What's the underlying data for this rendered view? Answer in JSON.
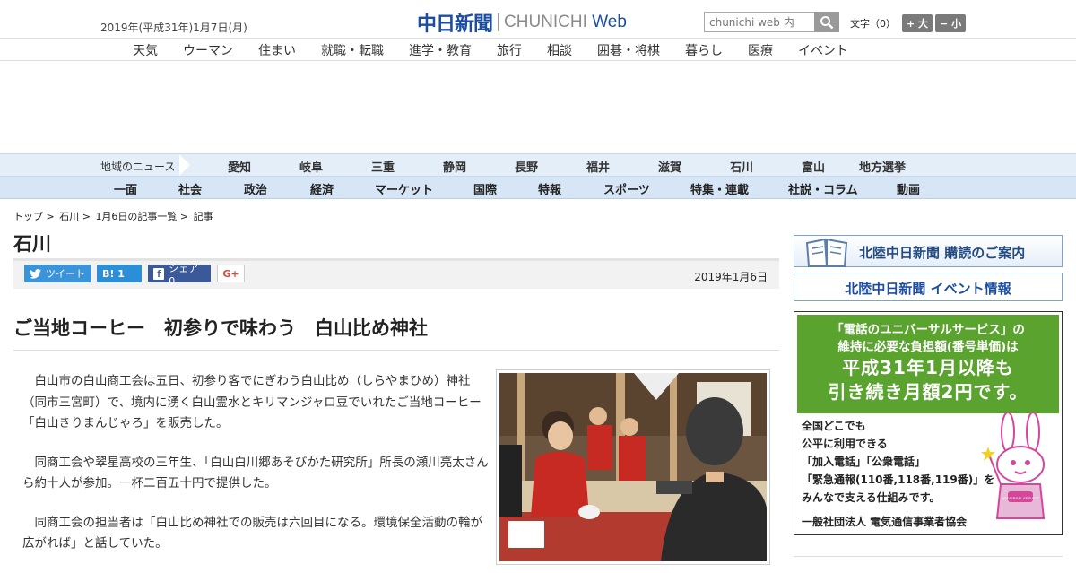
{
  "header": {
    "date": "2019年(平成31年)1月7日(月)",
    "logo_jp": "中日新聞",
    "logo_en_a": "CHUNICHI ",
    "logo_en_b": "Web",
    "search_placeholder": "chunichi web 内",
    "font_label": "文字（0）",
    "font_large": "+ 大",
    "font_small": "− 小"
  },
  "nav_main": [
    "天気",
    "ウーマン",
    "住まい",
    "就職・転職",
    "進学・教育",
    "旅行",
    "相談",
    "囲碁・将棋",
    "暮らし",
    "医療",
    "イベント"
  ],
  "nav_region": {
    "label": "地域のニュース",
    "items": [
      "愛知",
      "岐阜",
      "三重",
      "静岡",
      "長野",
      "福井",
      "滋賀",
      "石川",
      "富山",
      "地方選挙"
    ]
  },
  "nav_category": [
    "一面",
    "社会",
    "政治",
    "経済",
    "マーケット",
    "国際",
    "特報",
    "スポーツ",
    "特集・連載",
    "社説・コラム",
    "動画"
  ],
  "breadcrumb": [
    "トップ",
    "石川",
    "1月6日の記事一覧",
    "記事"
  ],
  "section_title": "石川",
  "share": {
    "tweet": "ツイート",
    "hatena": "B! 1",
    "facebook": "シェア 0",
    "gplus": "G+"
  },
  "article": {
    "date": "2019年1月6日",
    "headline": "ご当地コーヒー　初参りで味わう　白山比め神社",
    "paragraphs": [
      "白山市の白山商工会は五日、初参り客でにぎわう白山比め（しらやまひめ）神社（同市三宮町）で、境内に湧く白山霊水とキリマンジャロ豆でいれたご当地コーヒー「白山きりまんじゃろ」を販売した。",
      "同商工会や翠星高校の三年生、「白山白川郷あそびかた研究所」所長の瀬川亮太さんら約十人が参加。一杯二百五十円で提供した。",
      "同商工会の担当者は「白山比め神社での販売は六回目になる。環境保全活動の輪が広がれば」と話していた。"
    ]
  },
  "sidebar": {
    "banner1": "北陸中日新聞 購読のご案内",
    "banner2": "北陸中日新聞 イベント情報",
    "ad": {
      "line1": "「電話のユニバーサルサービス」の",
      "line2": "維持に必要な負担額(番号単価)は",
      "line3": "平成31年1月以降も",
      "line4": "引き続き月額2円です。",
      "low1": "全国どこでも",
      "low2": "公平に利用できる",
      "low3": "「加入電話」「公衆電話」",
      "low4": "「緊急通報(110番,118番,119番)」を",
      "low5": "みんなで支える仕組みです。",
      "org": "一般社団法人 電気通信事業者協会",
      "mascot_label": "UNIVERSAL SERVICE"
    }
  }
}
